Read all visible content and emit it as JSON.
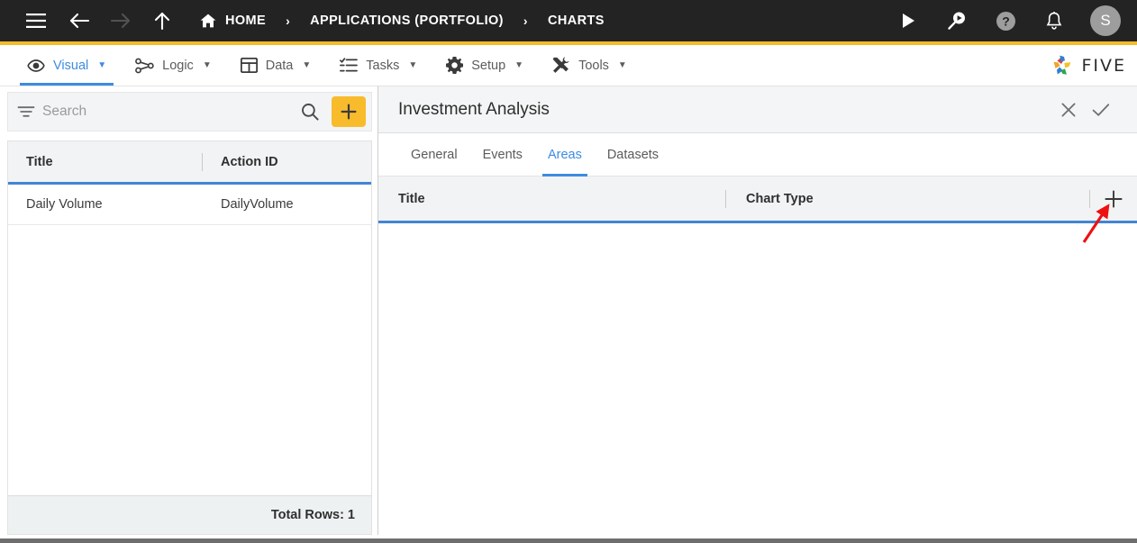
{
  "topbar": {
    "menu_icon": "hamburger-icon",
    "back_icon": "arrow-left-icon",
    "forward_icon": "arrow-right-icon",
    "up_icon": "arrow-up-icon",
    "breadcrumb": [
      {
        "label": "HOME",
        "icon": "home-icon"
      },
      {
        "label": "APPLICATIONS (PORTFOLIO)",
        "icon": ""
      },
      {
        "label": "CHARTS",
        "icon": ""
      }
    ],
    "separator": "›",
    "actions": [
      {
        "name": "run-icon",
        "glyph": "▶"
      },
      {
        "name": "search-run-icon",
        "glyph": ""
      },
      {
        "name": "help-icon",
        "glyph": "?"
      },
      {
        "name": "notifications-bell-icon",
        "glyph": ""
      }
    ],
    "avatar_initial": "S",
    "accent_color": "#f5bb2b",
    "bar_color": "#232323"
  },
  "menubar": {
    "items": [
      {
        "label": "Visual",
        "icon": "eye-icon",
        "caret": "▼",
        "active": true
      },
      {
        "label": "Logic",
        "icon": "logic-nodes-icon",
        "caret": "▼",
        "active": false
      },
      {
        "label": "Data",
        "icon": "table-grid-icon",
        "caret": "▼",
        "active": false
      },
      {
        "label": "Tasks",
        "icon": "checklist-icon",
        "caret": "▼",
        "active": false
      },
      {
        "label": "Setup",
        "icon": "gear-icon",
        "caret": "▼",
        "active": false
      },
      {
        "label": "Tools",
        "icon": "tools-wrench-screwdriver-icon",
        "caret": "▼",
        "active": false
      }
    ],
    "logo_text": "FIVE",
    "active_color": "#3d8ce0"
  },
  "left_panel": {
    "search": {
      "placeholder": "Search",
      "value": ""
    },
    "filter_icon": "filter-icon",
    "search_icon": "search-icon",
    "add_button_label": "+",
    "add_button_color": "#f8bb2c",
    "columns": [
      "Title",
      "Action ID"
    ],
    "rows": [
      {
        "title": "Daily Volume",
        "action_id": "DailyVolume"
      }
    ],
    "total_rows_label": "Total Rows: 1"
  },
  "right_panel": {
    "title": "Investment Analysis",
    "close_icon": "close-x-icon",
    "confirm_icon": "check-tick-icon",
    "tabs": [
      {
        "label": "General",
        "active": false
      },
      {
        "label": "Events",
        "active": false
      },
      {
        "label": "Areas",
        "active": true
      },
      {
        "label": "Datasets",
        "active": false
      }
    ],
    "grid": {
      "columns": [
        "Title",
        "Chart Type"
      ],
      "add_row_icon": "plus-icon",
      "rows": []
    }
  },
  "annotation": {
    "arrow_color": "#ee1111",
    "points_to": "plus-icon"
  }
}
